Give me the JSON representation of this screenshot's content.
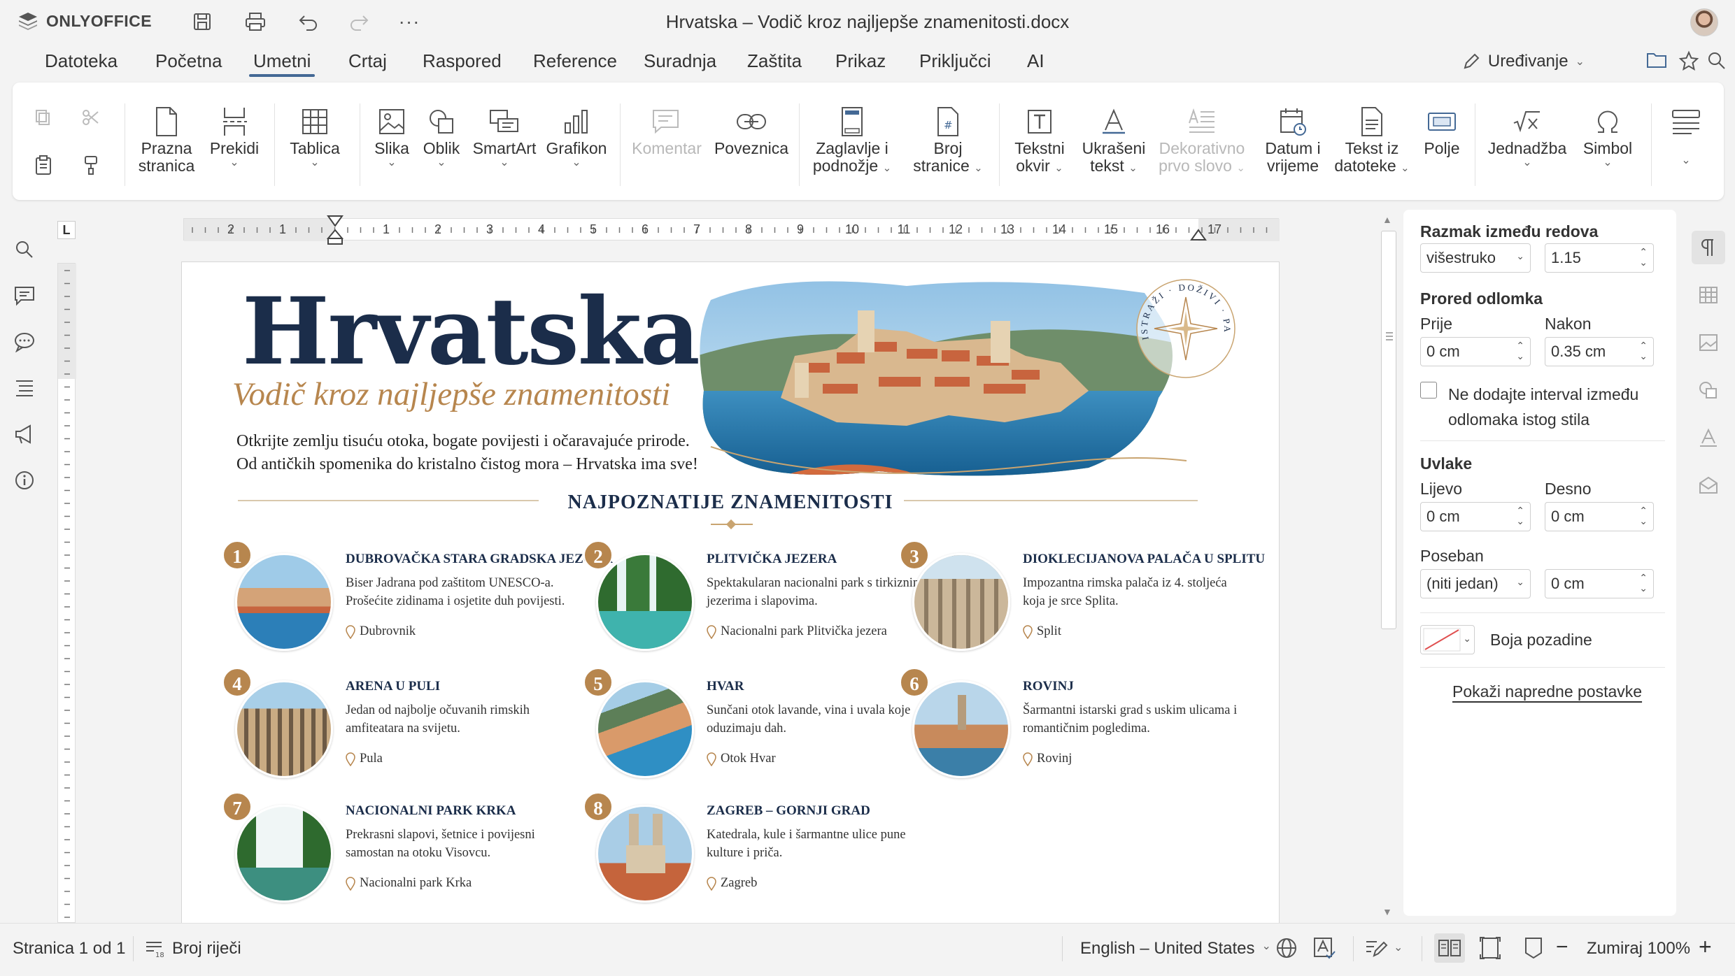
{
  "app": {
    "logo": "ONLYOFFICE",
    "doc_title": "Hrvatska – Vodič kroz najljepše znamenitosti.docx"
  },
  "menu": [
    "Datoteka",
    "Početna",
    "Umetni",
    "Crtaj",
    "Raspored",
    "Reference",
    "Suradnja",
    "Zaštita",
    "Prikaz",
    "Priključci",
    "AI"
  ],
  "active_menu": "Umetni",
  "editing_mode": "Uređivanje",
  "ribbon": {
    "blank_page": [
      "Prazna",
      "stranica"
    ],
    "breaks": "Prekidi",
    "table": "Tablica",
    "image": "Slika",
    "shape": "Oblik",
    "smartart": "SmartArt",
    "chart": "Grafikon",
    "comment": "Komentar",
    "hyperlink": "Poveznica",
    "header_footer": [
      "Zaglavlje i",
      "podnožje"
    ],
    "page_number": [
      "Broj",
      "stranice"
    ],
    "text_box": [
      "Tekstni",
      "okvir"
    ],
    "text_art": [
      "Ukrašeni",
      "tekst"
    ],
    "drop_cap": [
      "Dekorativno",
      "prvo slovo"
    ],
    "date_time": [
      "Datum i",
      "vrijeme"
    ],
    "text_from_file": [
      "Tekst iz",
      "datoteke"
    ],
    "field": "Polje",
    "equation": "Jednadžba",
    "symbol": "Simbol"
  },
  "ruler": {
    "corner": "L",
    "ticks": [
      "2",
      "1",
      "1",
      "2",
      "3",
      "4",
      "5",
      "6",
      "7",
      "8",
      "9",
      "10",
      "11",
      "12",
      "13",
      "14",
      "15",
      "16",
      "17"
    ]
  },
  "document": {
    "title": "Hrvatska",
    "subtitle": "Vodič kroz najljepše znamenitosti",
    "intro_1": "Otkrijte zemlju tisuću otoka, bogate povijesti i očaravajuće prirode.",
    "intro_2": "Od antičkih spomenika do kristalno čistog mora – Hrvatska ima sve!",
    "stamp": "ISTRAŽI · DOŽIVI · PAMTI",
    "section_title": "NAJPOZNATIJE ZNAMENITOSTI",
    "cards": [
      {
        "num": "1",
        "title": "DUBROVAČKA STARA GRADSKA JEZGRA",
        "desc": "Biser Jadrana pod zaštitom UNESCO-a. Prošećite zidinama i osjetite duh povijesti.",
        "loc": "Dubrovnik"
      },
      {
        "num": "2",
        "title": "PLITVIČKA JEZERA",
        "desc": "Spektakularan nacionalni park s tirkiznim jezerima i slapovima.",
        "loc": "Nacionalni park Plitvička jezera"
      },
      {
        "num": "3",
        "title": "DIOKLECIJANOVA PALAČA U SPLITU",
        "desc": "Impozantna rimska palača iz 4. stoljeća koja je srce Splita.",
        "loc": "Split"
      },
      {
        "num": "4",
        "title": "ARENA U PULI",
        "desc": "Jedan od najbolje očuvanih rimskih amfiteatara na svijetu.",
        "loc": "Pula"
      },
      {
        "num": "5",
        "title": "HVAR",
        "desc": "Sunčani otok lavande, vina i uvala koje oduzimaju dah.",
        "loc": "Otok Hvar"
      },
      {
        "num": "6",
        "title": "ROVINJ",
        "desc": "Šarmantni istarski grad s uskim ulicama i romantičnim pogledima.",
        "loc": "Rovinj"
      },
      {
        "num": "7",
        "title": "NACIONALNI PARK KRKA",
        "desc": "Prekrasni slapovi, šetnice i povijesni samostan na otoku Visovcu.",
        "loc": "Nacionalni park Krka"
      },
      {
        "num": "8",
        "title": "ZAGREB – GORNJI GRAD",
        "desc": "Katedrala, kule i šarmantne ulice pune kulture i priča.",
        "loc": "Zagreb"
      }
    ]
  },
  "panel": {
    "line_spacing_title": "Razmak između redova",
    "line_spacing_type": "višestruko",
    "line_spacing_value": "1.15",
    "para_spacing_title": "Prored odlomka",
    "before_label": "Prije",
    "before_value": "0 cm",
    "after_label": "Nakon",
    "after_value": "0.35 cm",
    "dont_add_1": "Ne dodajte interval između",
    "dont_add_2": "odlomaka istog stila",
    "indents_title": "Uvlake",
    "left_label": "Lijevo",
    "left_value": "0 cm",
    "right_label": "Desno",
    "right_value": "0 cm",
    "special_label": "Poseban",
    "special_type": "(niti jedan)",
    "special_value": "0 cm",
    "bg_color": "Boja pozadine",
    "advanced": "Pokaži napredne postavke"
  },
  "status": {
    "page": "Stranica 1 od 1",
    "word_count": "Broj riječi",
    "language": "English – United States",
    "zoom": "Zumiraj 100%"
  },
  "colors": {
    "accent": "#446995",
    "navy": "#1b2d4a",
    "gold": "#b7864e"
  }
}
